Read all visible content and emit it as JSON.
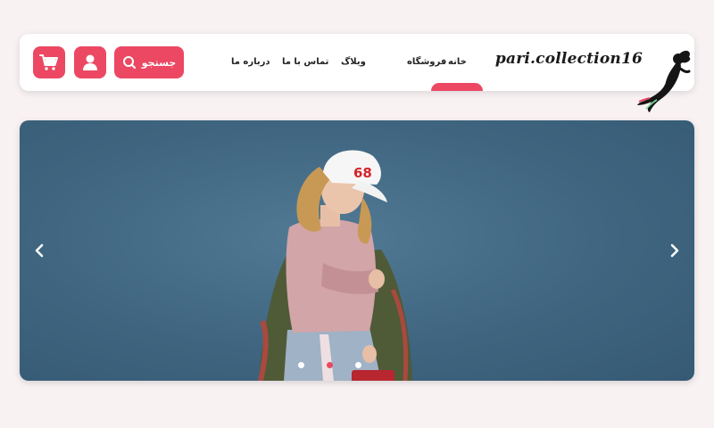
{
  "header": {
    "brand": "pari.collection16",
    "nav": [
      "خانه",
      "فروشگاه",
      "ویلاگ",
      "تماس با ما",
      "درباره ما"
    ],
    "active_nav": "خانه",
    "search_label": "جستجو",
    "icons": {
      "logo": "mermaid-logo-icon",
      "search": "search-icon",
      "user": "user-icon",
      "cart": "cart-icon"
    }
  },
  "slider": {
    "image": "model-white-cap-pink-sweater-photo",
    "slide_count": 3,
    "active_slide": 2,
    "icons": {
      "prev": "chevron-left-icon",
      "next": "chevron-right-icon"
    }
  },
  "colors": {
    "accent": "#ec4863",
    "background": "#f8f2f3",
    "hero_background": "#3f6580"
  }
}
